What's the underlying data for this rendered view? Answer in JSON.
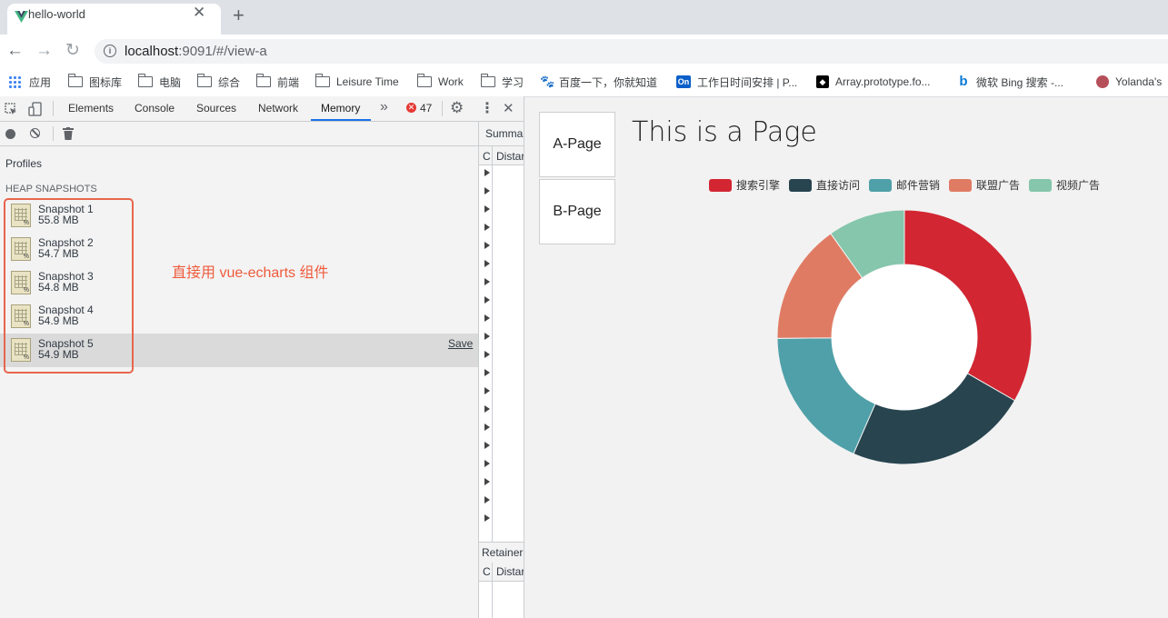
{
  "browser": {
    "tab_title": "hello-world",
    "url_host": "localhost",
    "url_rest": ":9091/#/view-a"
  },
  "bookmarks": [
    {
      "label": "应用",
      "icon": "apps-grid-icon"
    },
    {
      "label": "图标库",
      "icon": "folder-icon"
    },
    {
      "label": "电脑",
      "icon": "folder-icon"
    },
    {
      "label": "综合",
      "icon": "folder-icon"
    },
    {
      "label": "前端",
      "icon": "folder-icon"
    },
    {
      "label": "Leisure Time",
      "icon": "folder-icon"
    },
    {
      "label": "Work",
      "icon": "folder-icon"
    },
    {
      "label": "学习",
      "icon": "folder-icon"
    },
    {
      "label": "百度一下，你就知道",
      "icon": "baidu-icon"
    },
    {
      "label": "工作日时间安排 | P...",
      "icon": "on-icon"
    },
    {
      "label": "Array.prototype.fo...",
      "icon": "mdn-icon"
    },
    {
      "label": "微软 Bing 搜索 -...",
      "icon": "bing-icon"
    },
    {
      "label": "Yolanda's",
      "icon": "avatar-icon"
    }
  ],
  "devtools": {
    "tabs": [
      "Elements",
      "Console",
      "Sources",
      "Network",
      "Memory"
    ],
    "active_tab": "Memory",
    "error_count": "47",
    "profiles_label": "Profiles",
    "section_label": "HEAP SNAPSHOTS",
    "snapshots": [
      {
        "name": "Snapshot 1",
        "size": "55.8 MB"
      },
      {
        "name": "Snapshot 2",
        "size": "54.7 MB"
      },
      {
        "name": "Snapshot 3",
        "size": "54.8 MB"
      },
      {
        "name": "Snapshot 4",
        "size": "54.9 MB"
      },
      {
        "name": "Snapshot 5",
        "size": "54.9 MB"
      }
    ],
    "save_label": "Save",
    "summary_label": "Summa",
    "col_c": "C",
    "col_distance": "Distar",
    "retainers_label": "Retainers",
    "col_distance2": "Distar"
  },
  "annotation": "直接用 vue-echarts 组件",
  "page": {
    "nav": [
      "A-Page",
      "B-Page"
    ],
    "title": "This is a Page"
  },
  "chart_data": {
    "type": "pie",
    "title": "",
    "legend_position": "top",
    "categories": [
      "搜索引擎",
      "直接访问",
      "邮件营销",
      "联盟广告",
      "视频广告"
    ],
    "values": [
      335,
      234,
      184,
      154,
      99
    ],
    "colors": [
      "#d22632",
      "#27444f",
      "#4fa0a8",
      "#e07b63",
      "#85c6ac"
    ]
  }
}
